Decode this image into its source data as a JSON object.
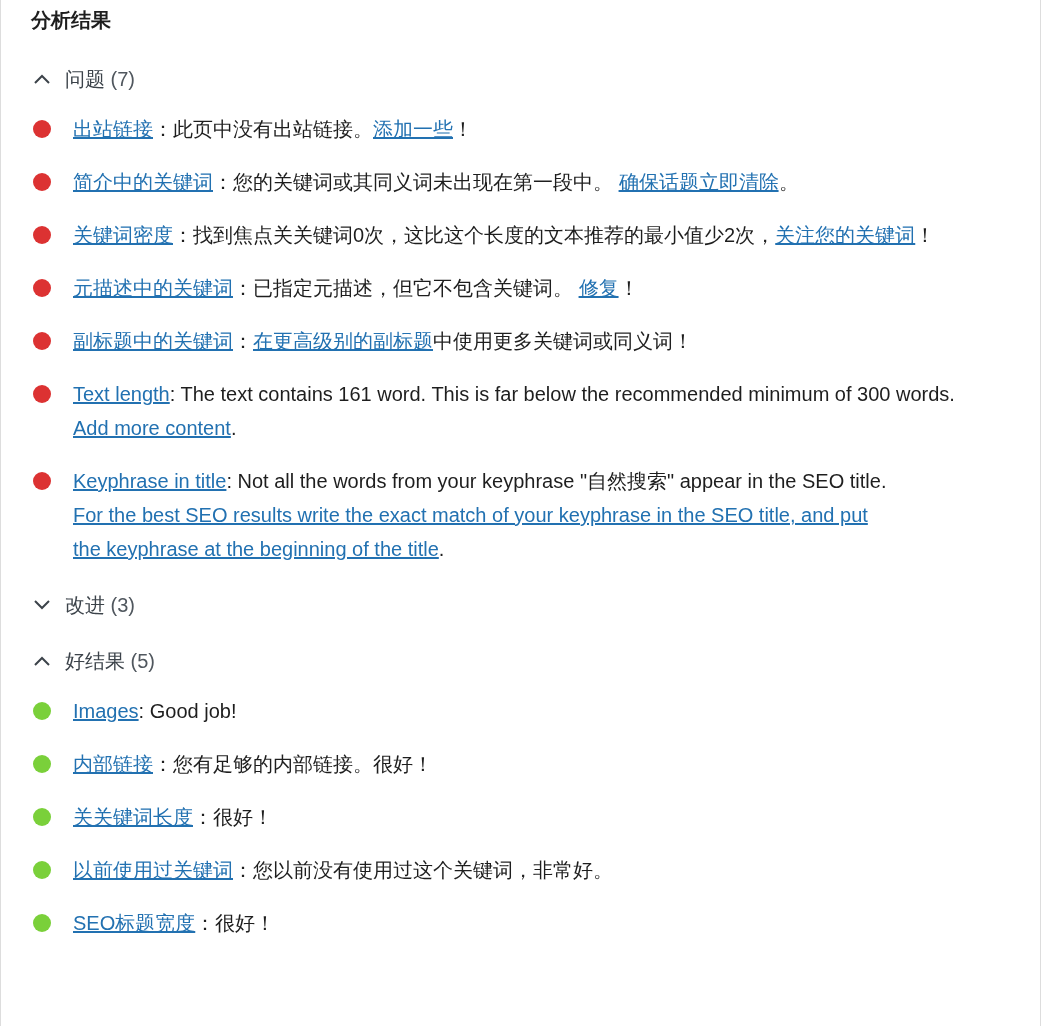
{
  "title": "分析结果",
  "sections": [
    {
      "label": "问题",
      "count": "(7)",
      "expanded": true,
      "items": [
        {
          "color": "#dc3232",
          "parts": [
            {
              "kind": "link",
              "text": "出站链接"
            },
            {
              "kind": "text",
              "text": "：此页中没有出站链接。"
            },
            {
              "kind": "link",
              "text": "添加一些"
            },
            {
              "kind": "text",
              "text": "！"
            }
          ]
        },
        {
          "color": "#dc3232",
          "parts": [
            {
              "kind": "link",
              "text": "简介中的关键词"
            },
            {
              "kind": "text",
              "text": "：您的关键词或其同义词未出现在第一段中。 "
            },
            {
              "kind": "link",
              "text": "确保话题立即清除"
            },
            {
              "kind": "text",
              "text": "。"
            }
          ]
        },
        {
          "color": "#dc3232",
          "parts": [
            {
              "kind": "link",
              "text": "关键词密度"
            },
            {
              "kind": "text",
              "text": "：找到焦点关关键词0次，这比这个长度的文本推荐的最小值少2次，"
            },
            {
              "kind": "link",
              "text": "关注您的关键词"
            },
            {
              "kind": "text",
              "text": "！"
            }
          ]
        },
        {
          "color": "#dc3232",
          "parts": [
            {
              "kind": "link",
              "text": "元描述中的关键词"
            },
            {
              "kind": "text",
              "text": "：已指定元描述，但它不包含关键词。 "
            },
            {
              "kind": "link",
              "text": "修复"
            },
            {
              "kind": "text",
              "text": "！"
            }
          ]
        },
        {
          "color": "#dc3232",
          "parts": [
            {
              "kind": "link",
              "text": "副标题中的关键词"
            },
            {
              "kind": "text",
              "text": "："
            },
            {
              "kind": "link",
              "text": "在更高级别的副标题"
            },
            {
              "kind": "text",
              "text": "中使用更多关键词或同义词！"
            }
          ]
        },
        {
          "color": "#dc3232",
          "parts": [
            {
              "kind": "link",
              "text": "Text length"
            },
            {
              "kind": "text",
              "text": ": The text contains 161 word. This is far below the recommended minimum of 300 words. "
            },
            {
              "kind": "link",
              "text": "Add more content"
            },
            {
              "kind": "text",
              "text": "."
            }
          ]
        },
        {
          "color": "#dc3232",
          "parts": [
            {
              "kind": "link",
              "text": "Keyphrase in title"
            },
            {
              "kind": "text",
              "text": ": Not all the words from your keyphrase \"自然搜索\" appear in the SEO title. "
            },
            {
              "kind": "link",
              "text": "For the best SEO results write the exact match of your keyphrase in the SEO title, and put"
            },
            {
              "kind": "break"
            },
            {
              "kind": "link",
              "text": "the keyphrase at the beginning of the title"
            },
            {
              "kind": "text",
              "text": "."
            }
          ]
        }
      ]
    },
    {
      "label": "改进",
      "count": "(3)",
      "expanded": false
    },
    {
      "label": "好结果",
      "count": "(5)",
      "expanded": true,
      "items": [
        {
          "color": "#7ad03a",
          "parts": [
            {
              "kind": "link",
              "text": "Images"
            },
            {
              "kind": "text",
              "text": ": Good job!"
            }
          ]
        },
        {
          "color": "#7ad03a",
          "parts": [
            {
              "kind": "link",
              "text": "内部链接"
            },
            {
              "kind": "text",
              "text": "：您有足够的内部链接。很好！"
            }
          ]
        },
        {
          "color": "#7ad03a",
          "parts": [
            {
              "kind": "link",
              "text": "关关键词长度"
            },
            {
              "kind": "text",
              "text": "：很好！"
            }
          ]
        },
        {
          "color": "#7ad03a",
          "parts": [
            {
              "kind": "link",
              "text": "以前使用过关键词"
            },
            {
              "kind": "text",
              "text": "：您以前没有使用过这个关键词，非常好。"
            }
          ]
        },
        {
          "color": "#7ad03a",
          "parts": [
            {
              "kind": "link",
              "text": "SEO标题宽度"
            },
            {
              "kind": "text",
              "text": "：很好！"
            }
          ]
        }
      ]
    }
  ]
}
